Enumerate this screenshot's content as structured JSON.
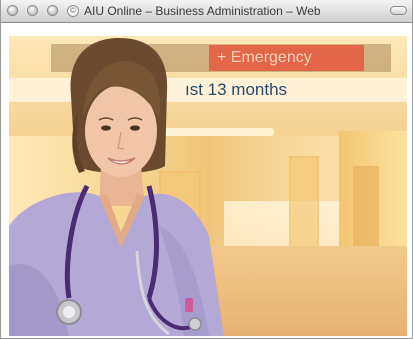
{
  "window": {
    "title": "AIU Online – Business Administration – Web"
  },
  "page": {
    "banner_text": "ıst 13 months",
    "emergency_sign": "+ Emergency"
  },
  "colors": {
    "banner_text": "#27496b",
    "emergency_sign": "#e65a3e",
    "scrubs": "#b3a8d6"
  },
  "icons": {
    "title_icon": "site-icon",
    "window_controls": [
      "close-icon",
      "minimize-icon",
      "zoom-icon"
    ]
  }
}
